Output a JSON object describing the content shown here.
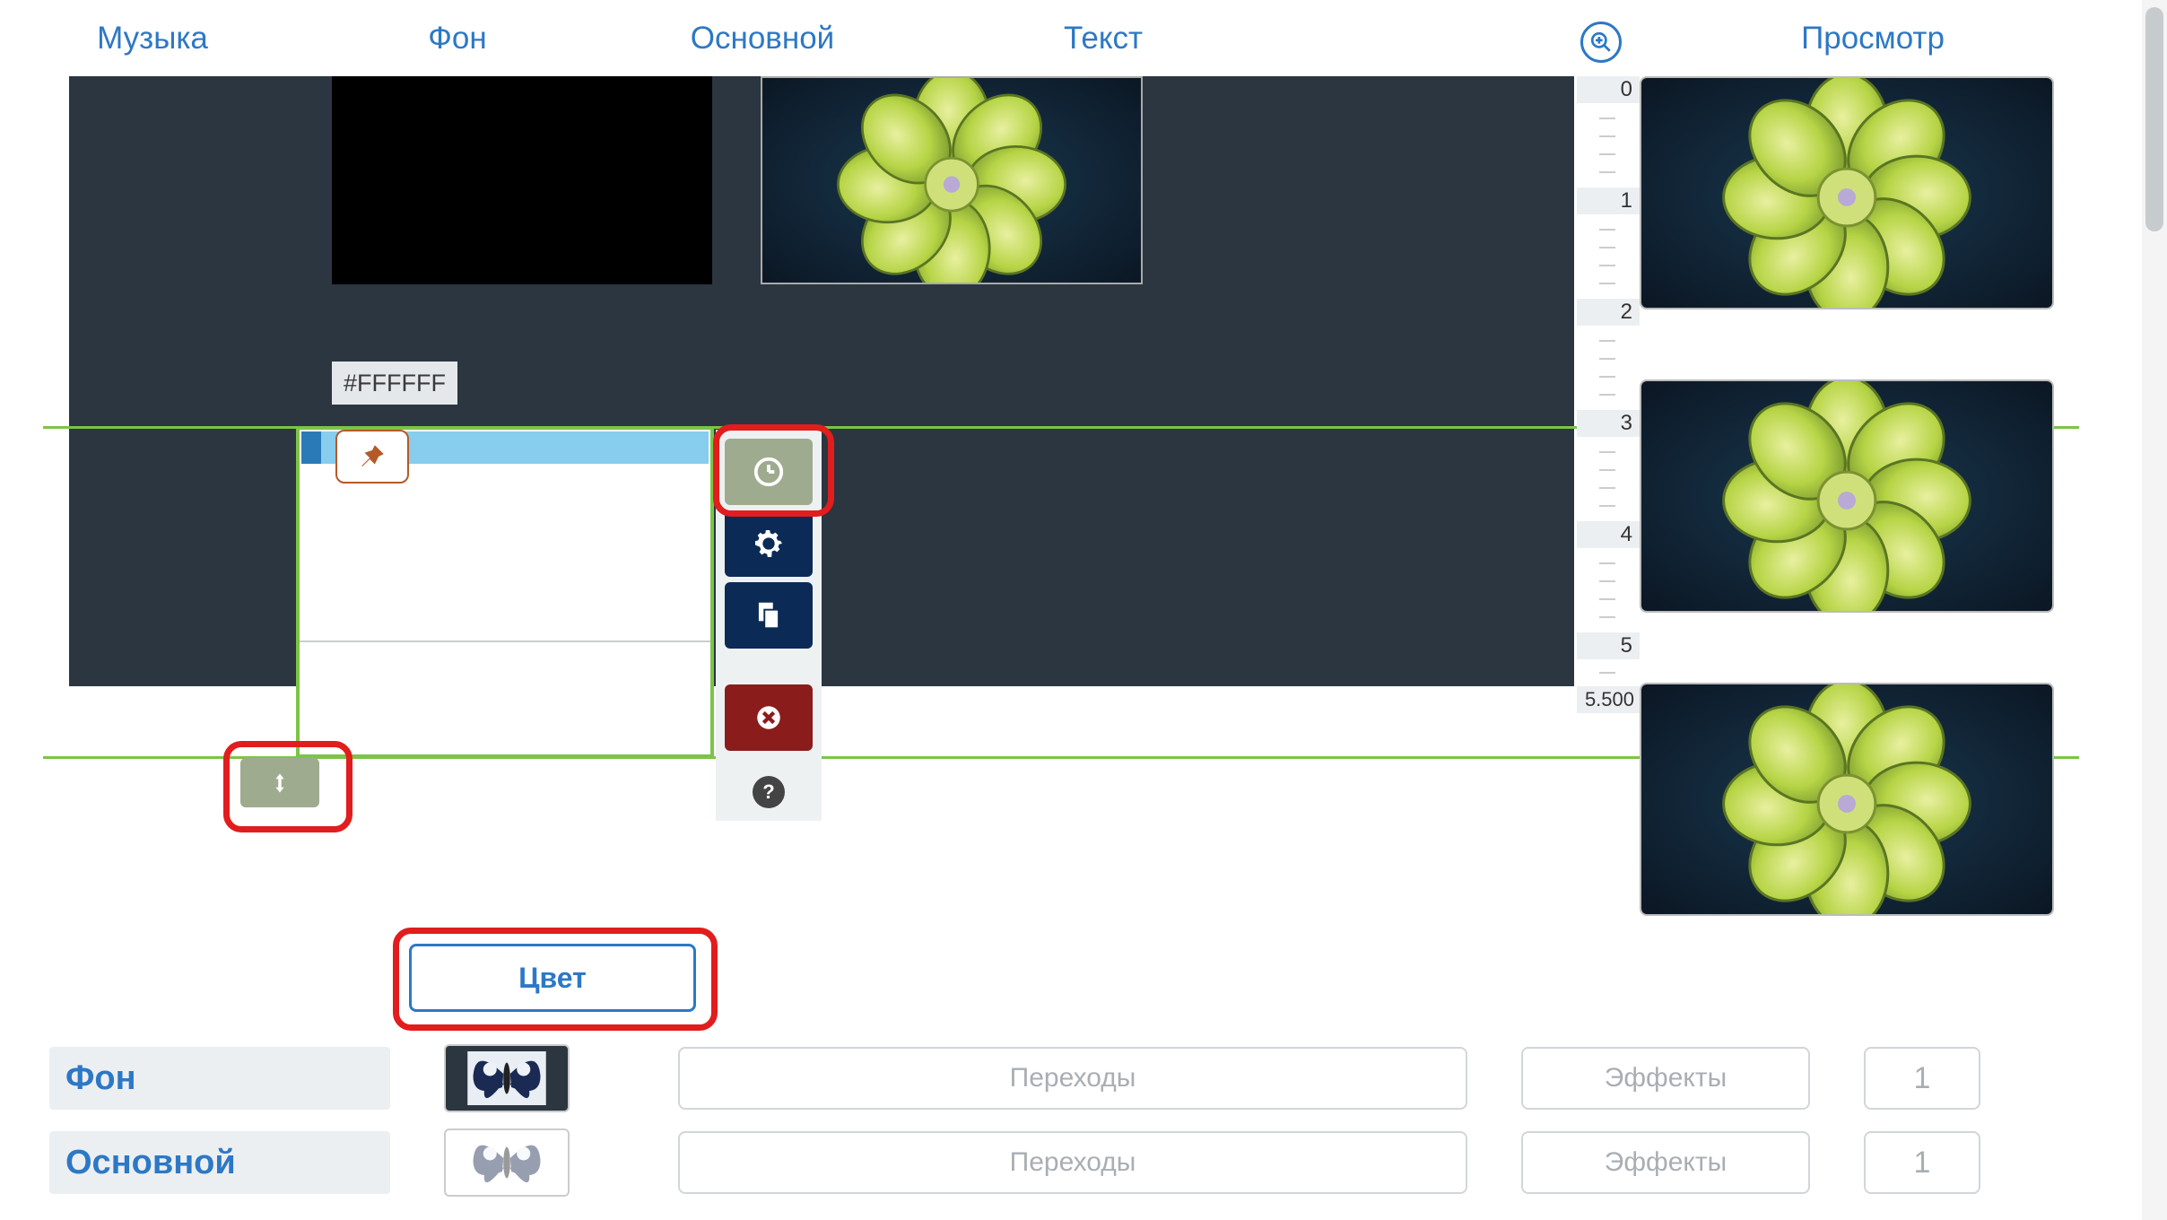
{
  "tabs": {
    "music": "Музыка",
    "background": "Фон",
    "main": "Основной",
    "text": "Текст",
    "preview": "Просмотр"
  },
  "hex_value": "#FFFFFF",
  "ruler": {
    "ticks": [
      0,
      1,
      2,
      3,
      4,
      5
    ],
    "final": "5.500"
  },
  "color_button_label": "Цвет",
  "bottom": {
    "rows": [
      {
        "label": "Фон",
        "transitions": "Переходы",
        "effects": "Эффекты",
        "count": "1"
      },
      {
        "label": "Основной",
        "transitions": "Переходы",
        "effects": "Эффекты",
        "count": "1"
      }
    ]
  },
  "toolbar": {
    "timing_tool": "timing",
    "settings_tool": "settings",
    "copy_tool": "copy",
    "delete_tool": "delete",
    "help_tool": "?"
  },
  "colors": {
    "accent": "#2d78c6",
    "track_bg": "#2b3640",
    "selection": "#7cc447",
    "highlight": "#e11d1d",
    "olive": "#9eab8e",
    "navy": "#0b2a56",
    "danger": "#8b1c1c"
  }
}
